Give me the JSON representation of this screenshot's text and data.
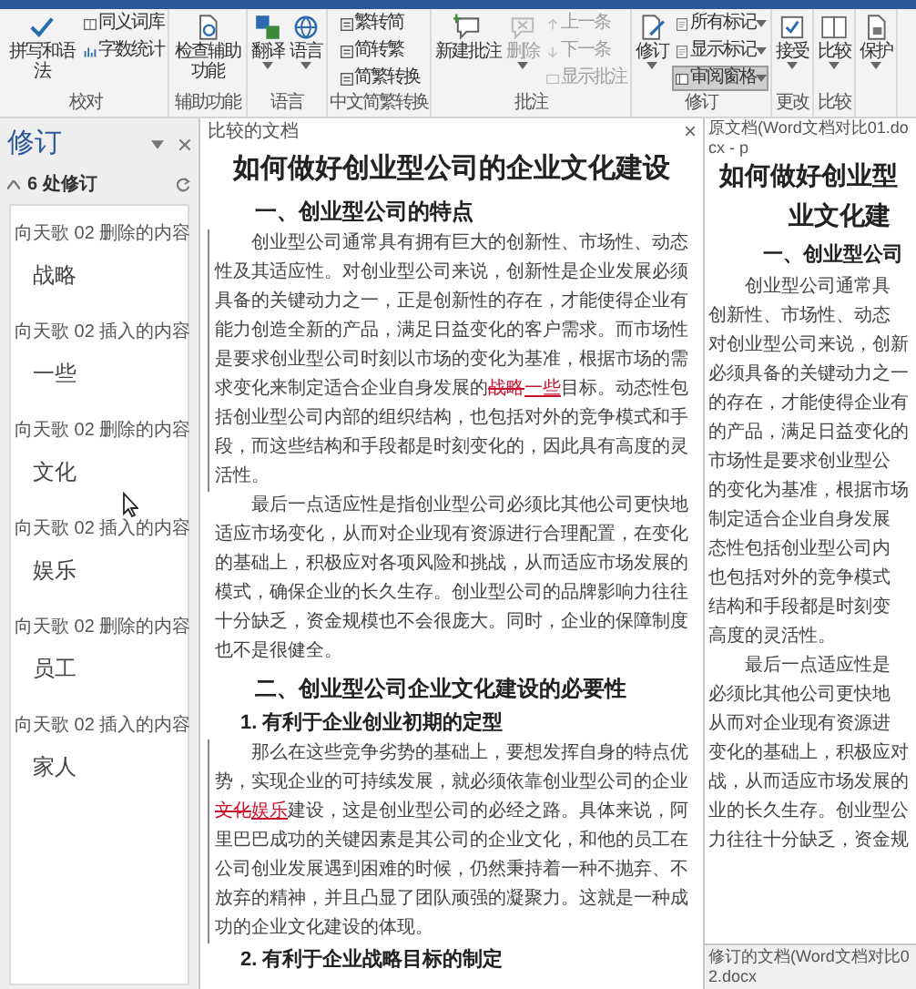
{
  "ribbon": {
    "groups": [
      {
        "label": "校对",
        "items": [
          {
            "label": "拼写和语法",
            "kind": "large",
            "disabled": false,
            "on": false,
            "dropdown": false
          },
          {
            "label": "同义词库",
            "kind": "small",
            "disabled": false,
            "on": false,
            "dropdown": false
          },
          {
            "label": "字数统计",
            "kind": "small",
            "disabled": false,
            "on": false,
            "dropdown": false
          }
        ]
      },
      {
        "label": "辅助功能",
        "items": [
          {
            "label": "检查辅助功能",
            "kind": "large",
            "disabled": false,
            "on": false,
            "dropdown": false
          }
        ]
      },
      {
        "label": "语言",
        "items": [
          {
            "label": "翻译",
            "kind": "large",
            "disabled": false,
            "on": false,
            "dropdown": true
          },
          {
            "label": "语言",
            "kind": "large",
            "disabled": false,
            "on": false,
            "dropdown": true
          }
        ]
      },
      {
        "label": "中文简繁转换",
        "items": [
          {
            "label": "繁转简",
            "kind": "small",
            "disabled": false,
            "on": false,
            "dropdown": false
          },
          {
            "label": "简转繁",
            "kind": "small",
            "disabled": false,
            "on": false,
            "dropdown": false
          },
          {
            "label": "简繁转换",
            "kind": "small",
            "disabled": false,
            "on": false,
            "dropdown": false
          }
        ]
      },
      {
        "label": "批注",
        "items": [
          {
            "label": "新建批注",
            "kind": "large",
            "disabled": false,
            "on": false,
            "dropdown": false
          },
          {
            "label": "删除",
            "kind": "large",
            "disabled": true,
            "on": false,
            "dropdown": true
          },
          {
            "label": "上一条",
            "kind": "small",
            "disabled": true,
            "on": false,
            "dropdown": false
          },
          {
            "label": "下一条",
            "kind": "small",
            "disabled": true,
            "on": false,
            "dropdown": false
          },
          {
            "label": "显示批注",
            "kind": "small",
            "disabled": true,
            "on": false,
            "dropdown": false
          }
        ]
      },
      {
        "label": "修订",
        "items": [
          {
            "label": "修订",
            "kind": "large",
            "disabled": false,
            "on": false,
            "dropdown": true
          },
          {
            "label": "所有标记",
            "kind": "small",
            "disabled": false,
            "on": false,
            "dropdown": true
          },
          {
            "label": "显示标记",
            "kind": "small",
            "disabled": false,
            "on": false,
            "dropdown": true
          },
          {
            "label": "审阅窗格",
            "kind": "small",
            "disabled": false,
            "on": true,
            "dropdown": true
          }
        ]
      },
      {
        "label": "更改",
        "items": [
          {
            "label": "接受",
            "kind": "large",
            "disabled": false,
            "on": false,
            "dropdown": true
          }
        ]
      },
      {
        "label": "比较",
        "items": [
          {
            "label": "比较",
            "kind": "large",
            "disabled": false,
            "on": false,
            "dropdown": true
          }
        ]
      },
      {
        "items": [
          {
            "label": "保护",
            "kind": "large",
            "disabled": false,
            "on": false,
            "dropdown": true
          }
        ]
      }
    ]
  },
  "revisions_pane": {
    "title": "修订",
    "count": "6 处修订",
    "items": [
      {
        "author": "向天歌 02",
        "action": "删除的内容",
        "content": "战略"
      },
      {
        "author": "向天歌 02",
        "action": "插入的内容",
        "content": "一些"
      },
      {
        "author": "向天歌 02",
        "action": "删除的内容",
        "content": "文化"
      },
      {
        "author": "向天歌 02",
        "action": "插入的内容",
        "content": "娱乐"
      },
      {
        "author": "向天歌 02",
        "action": "删除的内容",
        "content": "员工"
      },
      {
        "author": "向天歌 02",
        "action": "插入的内容",
        "content": "家人"
      }
    ]
  },
  "compared_document": {
    "caption": "比较的文档",
    "title": "如何做好创业型公司的企业文化建设",
    "blocks": [
      {
        "kind": "heading",
        "segments": [
          {
            "kind": "text",
            "text": "一、创业型公司的特点"
          }
        ]
      },
      {
        "kind": "paragraph",
        "segments": [
          {
            "kind": "text",
            "text": "创业型公司通常具有拥有巨大的创新性、市场性、动态性及其适应性。对创业型公司来说，创新性是企业发展必须具备的关键动力之一，正是创新性的存在，才能使得企业有能力创造全新的产品，满足日益变化的客户需求。而市场性是要求创业型公司时刻以市场的变化为基准，根据市场的需求变化来制定适合企业自身发展的"
          },
          {
            "kind": "deleted",
            "text": "战略"
          },
          {
            "kind": "inserted",
            "text": "一些"
          },
          {
            "kind": "text",
            "text": "目标。动态性包括创业型公司内部的组织结构，也包括对外的竞争模式和手段，而这些结构和手段都是时刻变化的，因此具有高度的灵活性。"
          }
        ]
      },
      {
        "kind": "paragraph",
        "segments": [
          {
            "kind": "text",
            "text": "最后一点适应性是指创业型公司必须比其他公司更快地适应市场变化，从而对企业现有资源进行合理配置，在变化的基础上，积极应对各项风险和挑战，从而适应市场发展的模式，确保企业的长久生存。创业型公司的品牌影响力往往十分缺乏，资金规模也不会很庞大。同时，企业的保障制度也不是很健全。"
          }
        ]
      },
      {
        "kind": "heading",
        "segments": [
          {
            "kind": "text",
            "text": "二、创业型公司企业文化建设的必要性"
          }
        ]
      },
      {
        "kind": "subheading",
        "segments": [
          {
            "kind": "text",
            "text": "1. 有利于企业创业初期的定型"
          }
        ]
      },
      {
        "kind": "paragraph",
        "segments": [
          {
            "kind": "text",
            "text": "那么在这些竞争劣势的基础上，要想发挥自身的特点优势，实现企业的可持续发展，就必须依靠创业型公司的企业"
          },
          {
            "kind": "deleted",
            "text": "文化"
          },
          {
            "kind": "inserted",
            "text": "娱乐"
          },
          {
            "kind": "text",
            "text": "建设，这是创业型公司的必经之路。具体来说，阿里巴巴成功的关键因素是其公司的企业文化，和他的员工在公司创业发展遇到困难的时候，仍然秉持着一种不抛弃、不放弃的精神，并且凸显了团队顽强的凝聚力。这就是一种成功的企业文化建设的体现。"
          }
        ]
      },
      {
        "kind": "subheading",
        "segments": [
          {
            "kind": "text",
            "text": "2. 有利于企业战略目标的制定"
          }
        ]
      }
    ]
  },
  "original_document": {
    "caption": "原文档(Word文档对比01.docx - p",
    "title_lines": [
      "如何做好创业型",
      "业文化建"
    ],
    "heading": "一、创业型公司",
    "lines": [
      {
        "text": "创业型公司通常具",
        "indent": true
      },
      {
        "text": "创新性、市场性、动态",
        "indent": false
      },
      {
        "text": "对创业型公司来说，创新",
        "indent": false
      },
      {
        "text": "必须具备的关键动力之一",
        "indent": false
      },
      {
        "text": "的存在，才能使得企业有",
        "indent": false
      },
      {
        "text": "的产品，满足日益变化的",
        "indent": false
      },
      {
        "text": "市场性是要求创业型公",
        "indent": false
      },
      {
        "text": "的变化为基准，根据市场",
        "indent": false
      },
      {
        "text": "制定适合企业自身发展",
        "indent": false
      },
      {
        "text": "态性包括创业型公司内",
        "indent": false
      },
      {
        "text": "也包括对外的竞争模式",
        "indent": false
      },
      {
        "text": "结构和手段都是时刻变",
        "indent": false
      },
      {
        "text": "高度的灵活性。",
        "indent": false
      },
      {
        "text": "最后一点适应性是",
        "indent": true
      },
      {
        "text": "必须比其他公司更快地",
        "indent": false
      },
      {
        "text": "从而对企业现有资源进",
        "indent": false
      },
      {
        "text": "变化的基础上，积极应对",
        "indent": false
      },
      {
        "text": "战，从而适应市场发展的",
        "indent": false
      },
      {
        "text": "业的长久生存。创业型公",
        "indent": false
      },
      {
        "text": "力往往十分缺乏，资金规",
        "indent": false
      }
    ]
  },
  "revised_document": {
    "caption": "修订的文档(Word文档对比02.docx"
  }
}
